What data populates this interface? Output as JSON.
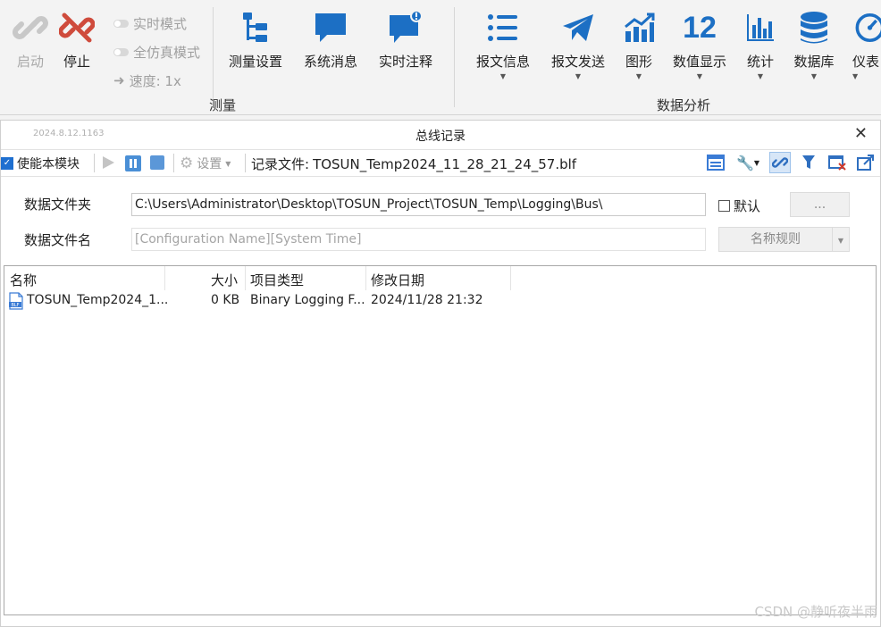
{
  "ribbon": {
    "start_label": "启动",
    "stop_label": "停止",
    "modes": [
      {
        "label": "实时模式"
      },
      {
        "label": "全仿真模式"
      }
    ],
    "speed_label": "速度: 1x",
    "buttons": [
      {
        "label": "测量设置",
        "icon": "tree-icon"
      },
      {
        "label": "系统消息",
        "icon": "chat-icon"
      },
      {
        "label": "实时注释",
        "icon": "annotation-icon"
      },
      {
        "label": "报文信息",
        "icon": "list-icon"
      },
      {
        "label": "报文发送",
        "icon": "send-icon"
      },
      {
        "label": "图形",
        "icon": "chart-icon"
      },
      {
        "label": "数值显示",
        "icon_text": "12"
      },
      {
        "label": "统计",
        "icon": "bar-chart-icon"
      },
      {
        "label": "数据库",
        "icon": "database-icon"
      },
      {
        "label": "仪表",
        "icon": "gauge-icon"
      }
    ],
    "group_measure": "测量",
    "group_analysis": "数据分析",
    "accent": "#1c6fc4",
    "stop_color": "#cf4b3c"
  },
  "panel": {
    "version": "2024.8.12.1163",
    "title": "总线记录",
    "enable_label": "使能本模块",
    "settings_label": "设置",
    "record_file_label": "记录文件:",
    "record_file_name": "TOSUN_Temp2024_11_28_21_24_57.blf",
    "folder_label": "数据文件夹",
    "folder_value": "C:\\Users\\Administrator\\Desktop\\TOSUN_Project\\TOSUN_Temp\\Logging\\Bus\\",
    "default_label": "默认",
    "browse_label": "...",
    "filename_label": "数据文件名",
    "filename_placeholder": "[Configuration Name][System Time]",
    "naming_rule_label": "名称规则"
  },
  "file_list": {
    "headers": [
      "名称",
      "大小",
      "项目类型",
      "修改日期"
    ],
    "rows": [
      {
        "name": "TOSUN_Temp2024_1...",
        "size": "0 KB",
        "type": "Binary Logging F...",
        "date": "2024/11/28 21:32",
        "icon": "blf-file-icon"
      }
    ]
  },
  "watermark": "CSDN @静听夜半雨"
}
